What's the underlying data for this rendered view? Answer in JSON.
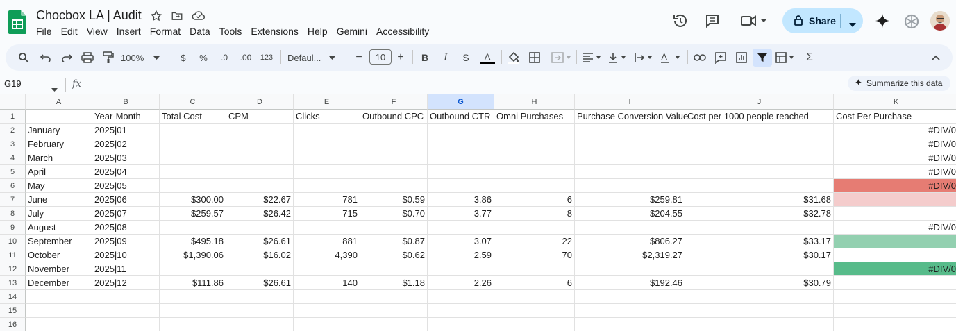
{
  "doc": {
    "title": "Chocbox LA | Audit"
  },
  "menu": [
    "File",
    "Edit",
    "View",
    "Insert",
    "Format",
    "Data",
    "Tools",
    "Extensions",
    "Help",
    "Gemini",
    "Accessibility"
  ],
  "share_label": "Share",
  "toolbar": {
    "zoom": "100%",
    "currency": "$",
    "percent": "%",
    "dec_less": ".0",
    "dec_more": ".00",
    "num_format": "123",
    "font": "Defaul...",
    "font_size": "10",
    "sum_icon": "Σ"
  },
  "formula_bar": {
    "name_box": "G19",
    "fx": "fx",
    "summarize": "Summarize this data"
  },
  "sheet": {
    "columns": [
      "A",
      "B",
      "C",
      "D",
      "E",
      "F",
      "G",
      "H",
      "I",
      "J",
      "K"
    ],
    "selected_column": "G",
    "row_numbers": [
      "1",
      "2",
      "3",
      "4",
      "5",
      "6",
      "7",
      "8",
      "9",
      "10",
      "11",
      "12",
      "13",
      "14",
      "15",
      "16"
    ],
    "header": [
      "",
      "Year-Month",
      "Total Cost",
      "CPM",
      "Clicks",
      "Outbound CPC",
      "Outbound CTR",
      "Omni Purchases",
      "Purchase Conversion Value",
      "Cost per 1000 people reached",
      "Cost Per Purchase"
    ],
    "rows": [
      [
        "January",
        "2025|01",
        "",
        "",
        "",
        "",
        "",
        "",
        "",
        "",
        "#DIV/0"
      ],
      [
        "February",
        "2025|02",
        "",
        "",
        "",
        "",
        "",
        "",
        "",
        "",
        "#DIV/0"
      ],
      [
        "March",
        "2025|03",
        "",
        "",
        "",
        "",
        "",
        "",
        "",
        "",
        "#DIV/0"
      ],
      [
        "April",
        "2025|04",
        "",
        "",
        "",
        "",
        "",
        "",
        "",
        "",
        "#DIV/0"
      ],
      [
        "May",
        "2025|05",
        "",
        "",
        "",
        "",
        "",
        "",
        "",
        "",
        "#DIV/0"
      ],
      [
        "June",
        "2025|06",
        "$300.00",
        "$22.67",
        "781",
        "$0.59",
        "3.86",
        "6",
        "$259.81",
        "$31.68",
        ""
      ],
      [
        "July",
        "2025|07",
        "$259.57",
        "$26.42",
        "715",
        "$0.70",
        "3.77",
        "8",
        "$204.55",
        "$32.78",
        ""
      ],
      [
        "August",
        "2025|08",
        "",
        "",
        "",
        "",
        "",
        "",
        "",
        "",
        "#DIV/0"
      ],
      [
        "September",
        "2025|09",
        "$495.18",
        "$26.61",
        "881",
        "$0.87",
        "3.07",
        "22",
        "$806.27",
        "$33.17",
        ""
      ],
      [
        "October",
        "2025|10",
        "$1,390.06",
        "$16.02",
        "4,390",
        "$0.62",
        "2.59",
        "70",
        "$2,319.27",
        "$30.17",
        ""
      ],
      [
        "November",
        "2025|11",
        "",
        "",
        "",
        "",
        "",
        "",
        "",
        "",
        "#DIV/0"
      ],
      [
        "December",
        "2025|12",
        "$111.86",
        "$26.61",
        "140",
        "$1.18",
        "2.26",
        "6",
        "$192.46",
        "$30.79",
        ""
      ],
      [
        "",
        "",
        "",
        "",
        "",
        "",
        "",
        "",
        "",
        "",
        ""
      ],
      [
        "",
        "",
        "",
        "",
        "",
        "",
        "",
        "",
        "",
        "",
        ""
      ],
      [
        "",
        "",
        "",
        "",
        "",
        "",
        "",
        "",
        "",
        "",
        ""
      ]
    ],
    "k_fill_colors": {
      "6": "#e67c73",
      "7": "#f4cccc",
      "10": "#93d0b0",
      "12": "#57bb8a"
    },
    "theme": {
      "accent": "#0b57d0",
      "share_bg": "#c2e7ff",
      "sheets_green": "#0f9d58"
    }
  }
}
